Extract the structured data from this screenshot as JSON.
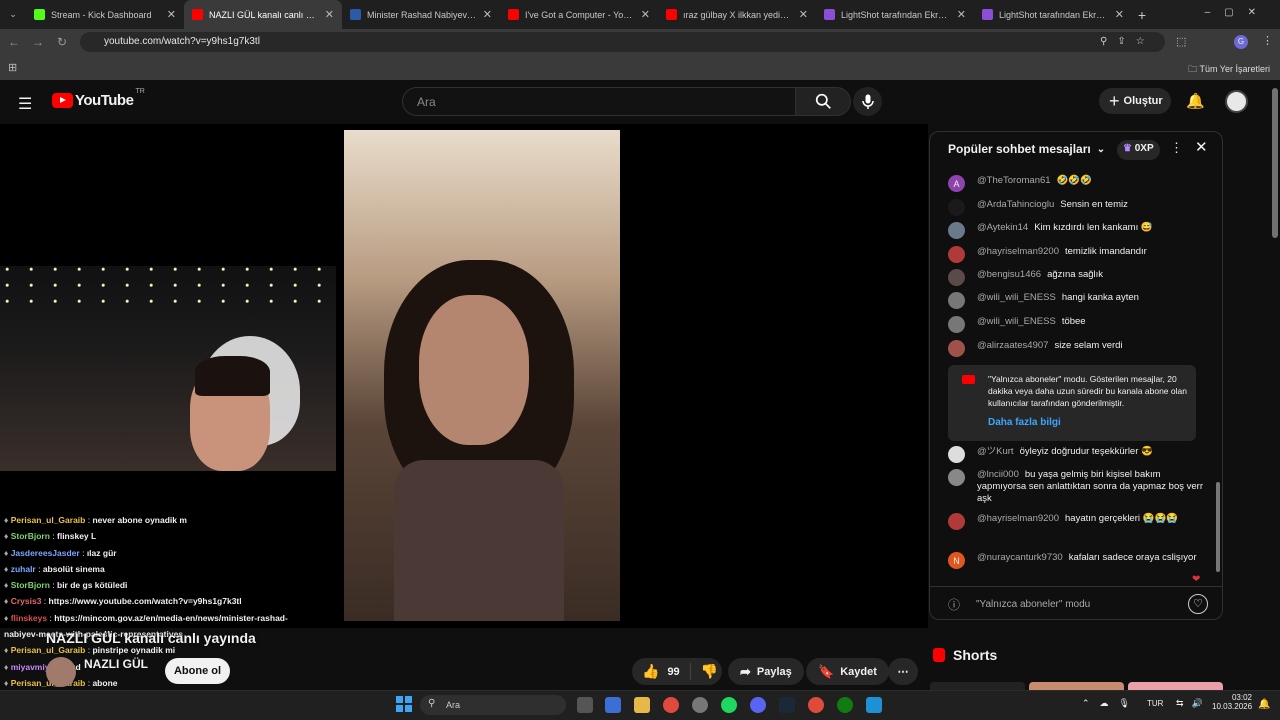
{
  "tabs": [
    {
      "title": "Stream - Kick Dashboard",
      "color": "#53fc18"
    },
    {
      "title": "NAZLI GÜL kanalı canlı yayında",
      "color": "#ff0000"
    },
    {
      "title": "Minister Rashad Nabiyev Meets",
      "color": "#2a5aa8"
    },
    {
      "title": "I've Got a Computer - YouTube",
      "color": "#ff0000"
    },
    {
      "title": "ıraz gülbay X ilkkan yedinci - Yo",
      "color": "#ff0000"
    },
    {
      "title": "LightShot tarafından Ekran Gör",
      "color": "#8a4fd6"
    },
    {
      "title": "LightShot tarafından Ekran Gör",
      "color": "#8a4fd6"
    }
  ],
  "browser": {
    "url": "youtube.com/watch?v=y9hs1g7k3tl",
    "bookmarks_label": "Tüm Yer İşaretleri"
  },
  "youtube": {
    "logo": "YouTube",
    "region": "TR",
    "search_placeholder": "Ara",
    "create_label": "Oluştur"
  },
  "video": {
    "title": "NAZLI GÜL kanalı canlı yayında",
    "channel": "NAZLI GÜL",
    "subscribe_label": "Abone ol",
    "likes": "99",
    "share_label": "Paylaş",
    "save_label": "Kaydet",
    "overlay_chat": [
      {
        "user": "Perisan_ul_Garaib",
        "text": "never abone oynadik m",
        "color": "#e8c24a"
      },
      {
        "user": "StorBjorn",
        "text": "flinskey L",
        "color": "#7dd36d"
      },
      {
        "user": "JasdereesJasder",
        "text": "ılaz gür",
        "color": "#7aa7ff"
      },
      {
        "user": "zuhalr",
        "text": "absolüt sinema",
        "color": "#7aa7ff"
      },
      {
        "user": "StorBjorn",
        "text": "bir de gs kötüledi",
        "color": "#7dd36d"
      },
      {
        "user": "Crysis3",
        "text": "https://www.youtube.com/watch?v=y9hs1g7k3tl",
        "color": "#e26b6b"
      },
      {
        "user": "flinskeys",
        "text": "https://mincom.gov.az/en/media-en/news/minister-rashad-",
        "color": "#d9534f"
      },
      {
        "user": "",
        "text": "nabiyev-meets-with-palestic-representatives",
        "color": "#fff"
      },
      {
        "user": "Perisan_ul_Garaib",
        "text": "pinstripe oynadik mi",
        "color": "#e8c24a"
      },
      {
        "user": "miyavmiyavv",
        "text": "xd",
        "color": "#c58af9"
      },
      {
        "user": "Perisan_ul_Garaib",
        "text": "abone",
        "color": "#e8c24a"
      },
      {
        "user": "JasdereesJasder",
        "text": "drama",
        "color": "#7aa7ff"
      },
      {
        "user": "StorBjorn",
        "text": "3 nolu",
        "color": "#7dd36d"
      }
    ]
  },
  "chat": {
    "header": "Popüler sohbet mesajları",
    "xp": "0XP",
    "messages": [
      {
        "author": "@TheToroman61",
        "text": "🤣🤣🤣",
        "avatar": "A",
        "avatar_color": "#8e44ad"
      },
      {
        "author": "@ArdaTahincioglu",
        "text": "Sensin en temiz",
        "avatar": "",
        "avatar_color": "#1a1a1a"
      },
      {
        "author": "@Aytekin14",
        "text": "Kim kızdırdı len kankamı 😅",
        "avatar": "",
        "avatar_color": "#6b7a8a"
      },
      {
        "author": "@hayriselman9200",
        "text": "temizlik imandandır",
        "avatar": "",
        "avatar_color": "#b03a3a"
      },
      {
        "author": "@bengisu1466",
        "text": "ağzına sağlık",
        "avatar": "",
        "avatar_color": "#5a4a4a"
      },
      {
        "author": "@wili_wili_ENESS",
        "text": "hangi kanka ayten",
        "avatar": "",
        "avatar_color": "#777"
      },
      {
        "author": "@wili_wili_ENESS",
        "text": "töbee",
        "avatar": "",
        "avatar_color": "#777"
      },
      {
        "author": "@alirzaates4907",
        "text": "size selam verdi",
        "avatar": "",
        "avatar_color": "#a0524a"
      }
    ],
    "notice": {
      "text": "\"Yalnızca aboneler\" modu. Gösterilen mesajlar, 20 dakika veya daha uzun süredir bu kanala abone olan kullanıcılar tarafından gönderilmiştir.",
      "link": "Daha fazla bilgi"
    },
    "messages2": [
      {
        "author": "@ツKurt",
        "text": "öyleyiz doğrudur teşekkürler 😎",
        "avatar": "",
        "avatar_color": "#ddd"
      },
      {
        "author": "@lncii000",
        "text": "bu yaşa gelmiş biri kişisel bakım yapmıyorsa sen anlattıktan sonra da yapmaz boş verr aşk",
        "avatar": "",
        "avatar_color": "#888"
      },
      {
        "author": "@hayriselman9200",
        "text": "hayatın gerçekleri 😭😭😭",
        "avatar": "",
        "avatar_color": "#b03a3a"
      },
      {
        "author": "@nuraycanturk9730",
        "text": "kafaları sadece oraya cslişıyor",
        "avatar": "N",
        "avatar_color": "#e0561f"
      }
    ],
    "footer": "\"Yalnızca aboneler\" modu"
  },
  "shorts_label": "Shorts",
  "taskbar": {
    "search": "Ara",
    "lang": "TUR",
    "time": "03:02",
    "date": "10.03.2026"
  }
}
